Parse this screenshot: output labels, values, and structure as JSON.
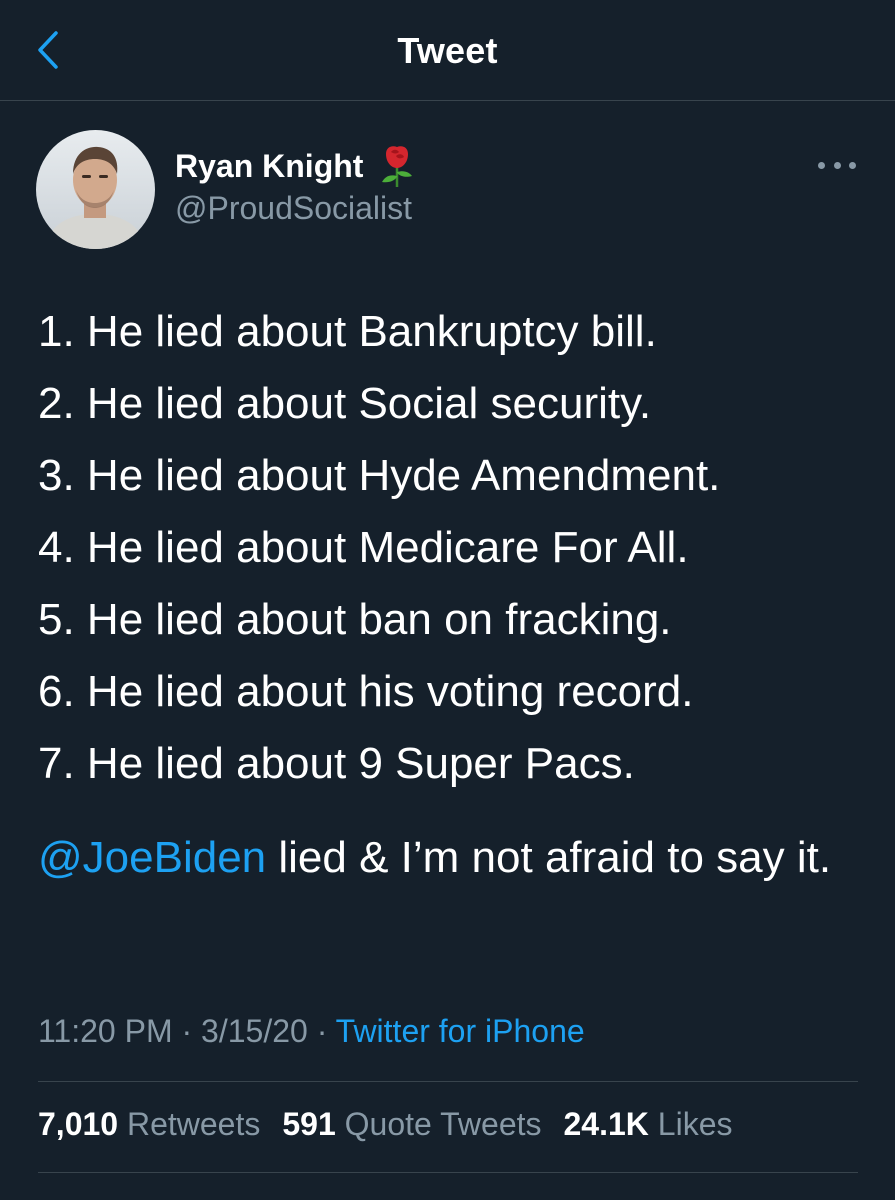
{
  "header": {
    "title": "Tweet",
    "back_icon": "chevron-left-icon"
  },
  "author": {
    "name": "Ryan Knight",
    "handle": "@ProudSocialist",
    "badge_icon": "rose-icon"
  },
  "tweet": {
    "lines": [
      "1. He lied about Bankruptcy bill.",
      "2. He lied about Social security.",
      "3. He lied about Hyde Amendment.",
      "4. He lied about Medicare For All.",
      "5. He lied about ban on fracking.",
      "6. He lied about his voting record.",
      "7. He lied about 9 Super Pacs."
    ],
    "mention": "@JoeBiden",
    "tail_text": " lied & I’m not afraid to say it."
  },
  "meta": {
    "time": "11:20 PM",
    "date": "3/15/20",
    "separator": "·",
    "source": "Twitter for iPhone"
  },
  "stats": {
    "retweets_count": "7,010",
    "retweets_label": "Retweets",
    "quotes_count": "591",
    "quotes_label": "Quote Tweets",
    "likes_count": "24.1K",
    "likes_label": "Likes"
  },
  "colors": {
    "background": "#15202b",
    "accent": "#1da1f2",
    "secondary_text": "#8899a6",
    "divider": "#38444d"
  }
}
